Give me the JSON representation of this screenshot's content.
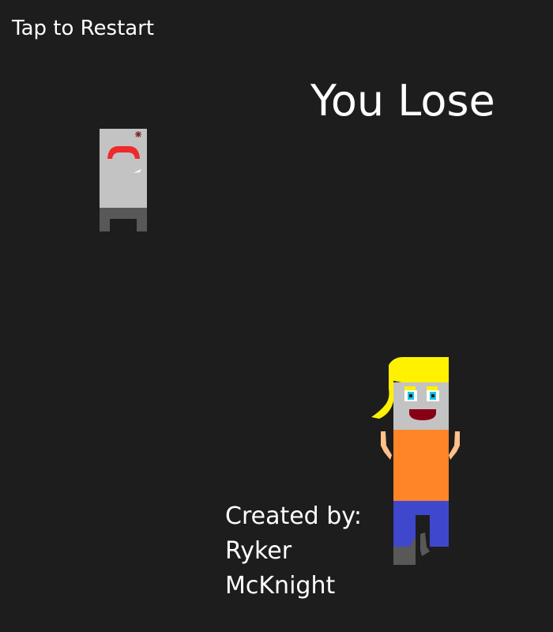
{
  "hud": {
    "restart_label": "Tap to Restart",
    "status_message": "You Lose"
  },
  "credits": {
    "heading": "Created by:",
    "first_name": "Ryker",
    "last_name": "McKnight"
  },
  "sprites": {
    "enemy": "fridge-monster-icon",
    "player": "blonde-character-icon"
  },
  "colors": {
    "background": "#1d1d1d",
    "text": "#ffffff",
    "enemy_body": "#c3c3c3",
    "enemy_legs": "#585858",
    "enemy_mouth": "#ee2a2a",
    "player_hair": "#fff200",
    "player_shirt": "#ff8527",
    "player_pants": "#3f48cc",
    "player_skin": "#c3c3c3",
    "player_arms": "#ffc28a"
  }
}
